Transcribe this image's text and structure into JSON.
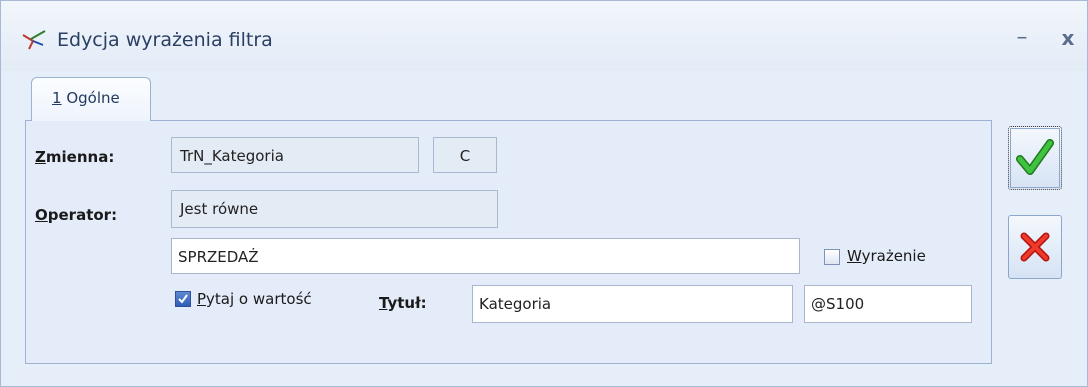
{
  "window": {
    "title": "Edycja wyrażenia filtra",
    "icon": "filter-funnel-icon",
    "minimize_label": "–",
    "close_label": "x"
  },
  "tabs": [
    {
      "number": "1",
      "label": " Ogólne",
      "active": true
    }
  ],
  "form": {
    "variable": {
      "label_accel": "Z",
      "label_rest": "mienna:",
      "value": "TrN_Kategoria",
      "type": "C"
    },
    "operator": {
      "label_accel": "O",
      "label_rest": "perator:",
      "value": "Jest równe"
    },
    "value_field": "SPRZEDAŻ",
    "expression_checkbox": {
      "accel": "W",
      "rest": "yrażenie",
      "checked": false
    },
    "ask_value_checkbox": {
      "accel": "P",
      "rest": "ytaj o wartość",
      "checked": true
    },
    "title": {
      "label_accel": "T",
      "label_rest": "ytuł:",
      "value": "Kategoria"
    },
    "code_field": "@S100"
  },
  "buttons": {
    "ok": {
      "icon": "green-checkmark-icon",
      "color": "#2ea12e"
    },
    "cancel": {
      "icon": "red-x-icon",
      "color": "#e0261c"
    }
  }
}
